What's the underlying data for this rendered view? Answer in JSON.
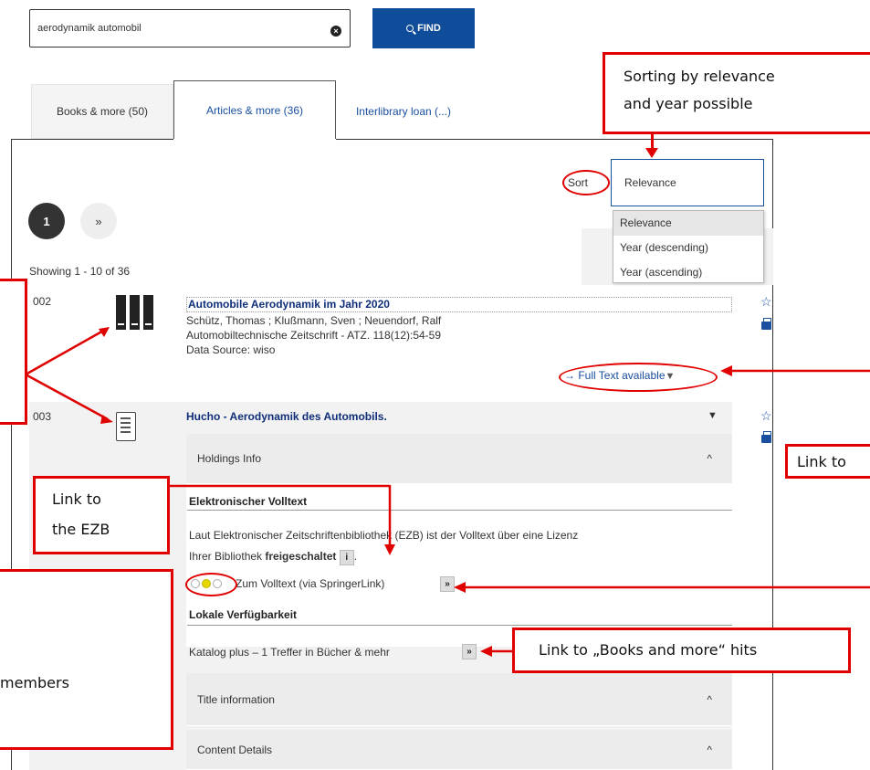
{
  "search": {
    "value": "aerodynamik automobil",
    "clear_symbol": "×",
    "find_label": "FIND"
  },
  "tabs": [
    {
      "label": "Books & more (50)"
    },
    {
      "label": "Articles & more (36)"
    },
    {
      "label": "Interlibrary loan (...)"
    }
  ],
  "sort": {
    "label": "Sort",
    "selected": "Relevance",
    "options": [
      "Relevance",
      "Year (descending)",
      "Year (ascending)"
    ]
  },
  "pagination": {
    "current": "1",
    "next": "»",
    "showing": "Showing 1 - 10 of 36"
  },
  "records": [
    {
      "number": "002",
      "title": "Automobile Aerodynamik im Jahr 2020",
      "authors": "Schütz, Thomas ; Klußmann, Sven ; Neuendorf, Ralf",
      "source": "Automobiltechnische Zeitschrift - ATZ. 118(12):54-59",
      "data_source": "Data Source: wiso",
      "fulltext": "→ Full Text available",
      "caret": "▼"
    },
    {
      "number": "003",
      "title": "Hucho - Aerodynamik des Automobils.",
      "caret": "▼",
      "holdings_label": "Holdings Info",
      "ezb_heading": "Elektronischer Volltext",
      "ezb_text_1": "Laut Elektronischer Zeitschriftenbibliothek (EZB) ist der Volltext über eine Lizenz",
      "ezb_text_2a": "Ihrer Bibliothek ",
      "ezb_text_2b": "freigeschaltet",
      "ezb_text_2c": ".",
      "info_btn": "i",
      "volltext_link": "Zum Volltext (via SpringerLink)",
      "arrow_btn": "»",
      "local_heading": "Lokale Verfügbarkeit",
      "local_text": "Katalog plus – 1 Treffer in Bücher & mehr",
      "title_info_label": "Title information",
      "content_label": "Content Details",
      "chevron_up": "^"
    }
  ],
  "actions": {
    "star": "☆"
  },
  "annotations": {
    "sorting": [
      "Sorting by relevance",
      "and year possible"
    ],
    "link_to": "Link to",
    "ezb": [
      "Link to",
      "the EZB"
    ],
    "members": "members",
    "books_hits": "Link to „Books and more“ hits"
  },
  "colors": {
    "accent": "#0f4c9a",
    "annotation": "#e00000",
    "record_bg": "#f2f2f2"
  }
}
